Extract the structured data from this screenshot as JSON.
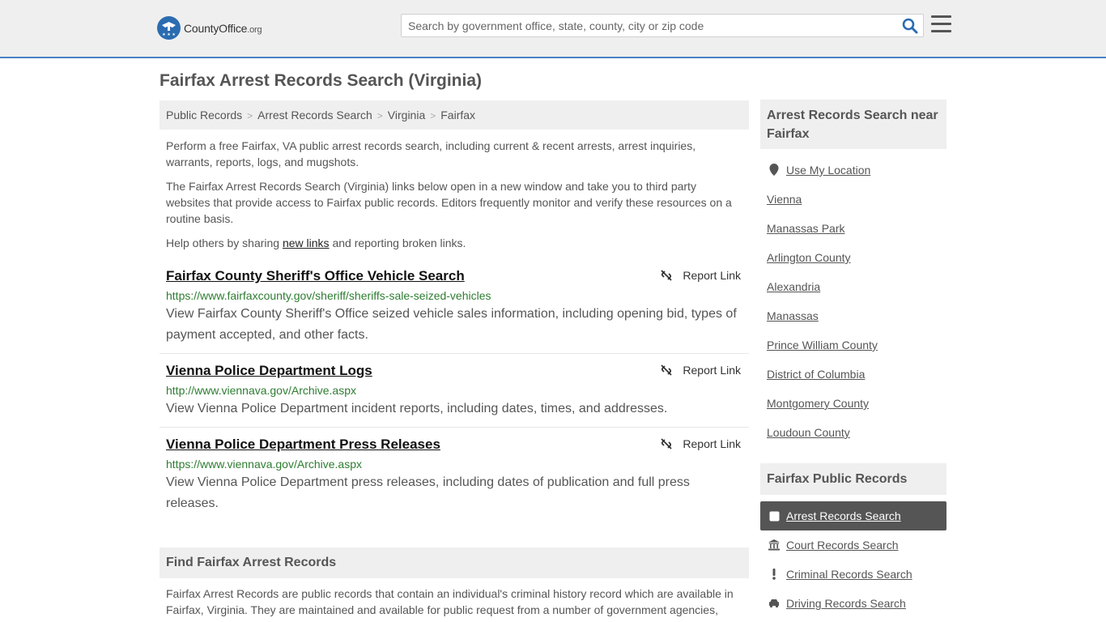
{
  "header": {
    "logo_name": "CountyOffice",
    "logo_tld": ".org",
    "search_placeholder": "Search by government office, state, county, city or zip code"
  },
  "page": {
    "title": "Fairfax Arrest Records Search (Virginia)"
  },
  "breadcrumb": [
    "Public Records",
    "Arrest Records Search",
    "Virginia",
    "Fairfax"
  ],
  "intro": {
    "p1": "Perform a free Fairfax, VA public arrest records search, including current & recent arrests, arrest inquiries, warrants, reports, logs, and mugshots.",
    "p2": "The Fairfax Arrest Records Search (Virginia) links below open in a new window and take you to third party websites that provide access to Fairfax public records. Editors frequently monitor and verify these resources on a routine basis.",
    "p3_before": "Help others by sharing ",
    "p3_link": "new links",
    "p3_after": " and reporting broken links."
  },
  "report_label": "Report Link",
  "results": [
    {
      "title": "Fairfax County Sheriff's Office Vehicle Search",
      "url": "https://www.fairfaxcounty.gov/sheriff/sheriffs-sale-seized-vehicles",
      "desc": "View Fairfax County Sheriff's Office seized vehicle sales information, including opening bid, types of payment accepted, and other facts."
    },
    {
      "title": "Vienna Police Department Logs",
      "url": "http://www.viennava.gov/Archive.aspx",
      "desc": "View Vienna Police Department incident reports, including dates, times, and addresses."
    },
    {
      "title": "Vienna Police Department Press Releases",
      "url": "https://www.viennava.gov/Archive.aspx",
      "desc": "View Vienna Police Department press releases, including dates of publication and full press releases."
    }
  ],
  "find": {
    "heading": "Find Fairfax Arrest Records",
    "text": "Fairfax Arrest Records are public records that contain an individual's criminal history record which are available in Fairfax, Virginia. They are maintained and available for public request from a number of government agencies,"
  },
  "sidebar": {
    "near_heading": "Arrest Records Search near Fairfax",
    "use_location": "Use My Location",
    "near_links": [
      "Vienna",
      "Manassas Park",
      "Arlington County",
      "Alexandria",
      "Manassas",
      "Prince William County",
      "District of Columbia",
      "Montgomery County",
      "Loudoun County"
    ],
    "records_heading": "Fairfax Public Records",
    "records": [
      {
        "label": "Arrest Records Search",
        "icon": "square-icon",
        "active": true
      },
      {
        "label": "Court Records Search",
        "icon": "courthouse-icon",
        "active": false
      },
      {
        "label": "Criminal Records Search",
        "icon": "exclamation-icon",
        "active": false
      },
      {
        "label": "Driving Records Search",
        "icon": "car-icon",
        "active": false
      }
    ]
  },
  "colors": {
    "accent_border": "#4a82c3",
    "url_green": "#2e7d32",
    "active_bg": "#555555"
  }
}
